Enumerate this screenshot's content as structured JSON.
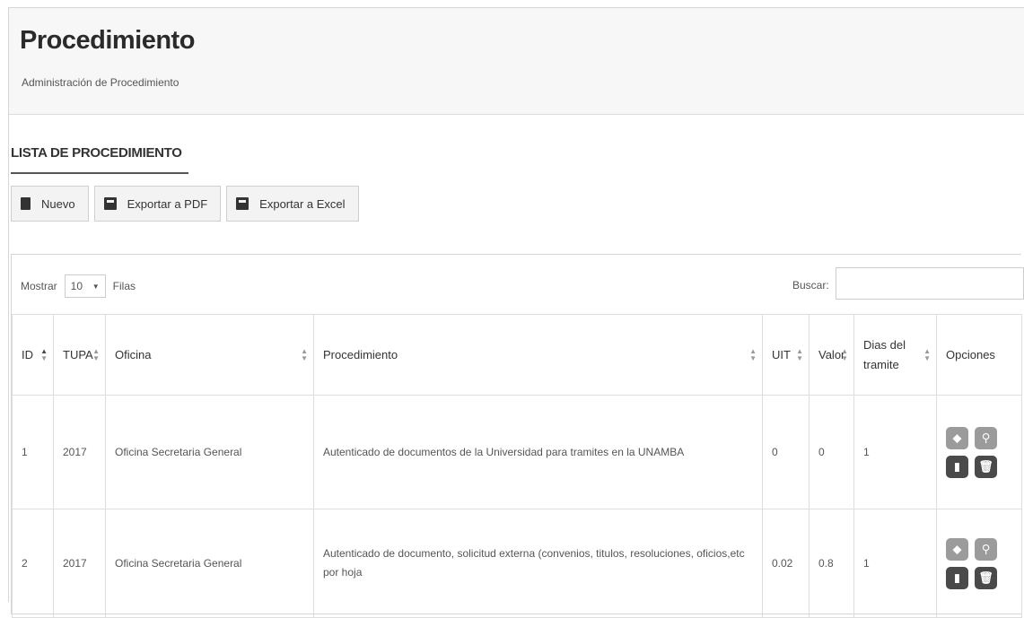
{
  "header": {
    "title": "Procedimiento",
    "subtitle": "Administración de Procedimiento"
  },
  "section": {
    "title": "LISTA DE PROCEDIMIENTO"
  },
  "toolbar": {
    "new_label": "Nuevo",
    "pdf_label": "Exportar a PDF",
    "excel_label": "Exportar a Excel"
  },
  "table_controls": {
    "show_label": "Mostrar",
    "rows_value": "10",
    "rows_suffix": "Filas",
    "search_label": "Buscar:"
  },
  "columns": [
    "ID",
    "TUPA",
    "Oficina",
    "Procedimiento",
    "UIT",
    "Valor",
    "Dias del tramite",
    "Opciones"
  ],
  "rows": [
    {
      "id": "1",
      "tupa": "2017",
      "oficina": "Oficina Secretaria General",
      "procedimiento": "Autenticado de documentos de la Universidad para tramites en la UNAMBA",
      "uit": "0",
      "valor": "0",
      "dias": "1"
    },
    {
      "id": "2",
      "tupa": "2017",
      "oficina": "Oficina Secretaria General",
      "procedimiento": "Autenticado de documento, solicitud externa (convenios, titulos, resoluciones, oficios,etc por hoja",
      "uit": "0.02",
      "valor": "0.8",
      "dias": "1"
    }
  ],
  "icons": {
    "new": "book-icon",
    "pdf": "file-icon",
    "excel": "file-icon",
    "tag": "tag-icon",
    "search": "search-icon",
    "view": "book-icon",
    "delete": "trash-icon"
  }
}
